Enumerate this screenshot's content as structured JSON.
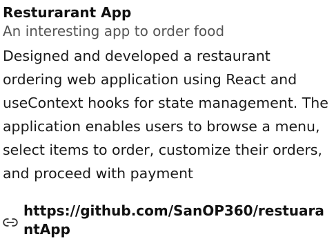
{
  "project": {
    "title": "Resturarant App",
    "subtitle": "An interesting app to order food",
    "description": "Designed and developed a restaurant ordering web application using React and useContext hooks for state management. The application enables users to browse a menu, select items to order, customize their orders, and proceed with payment",
    "link": {
      "icon": "link-icon",
      "url": "https://github.com/SanOP360/restuarantApp"
    }
  }
}
